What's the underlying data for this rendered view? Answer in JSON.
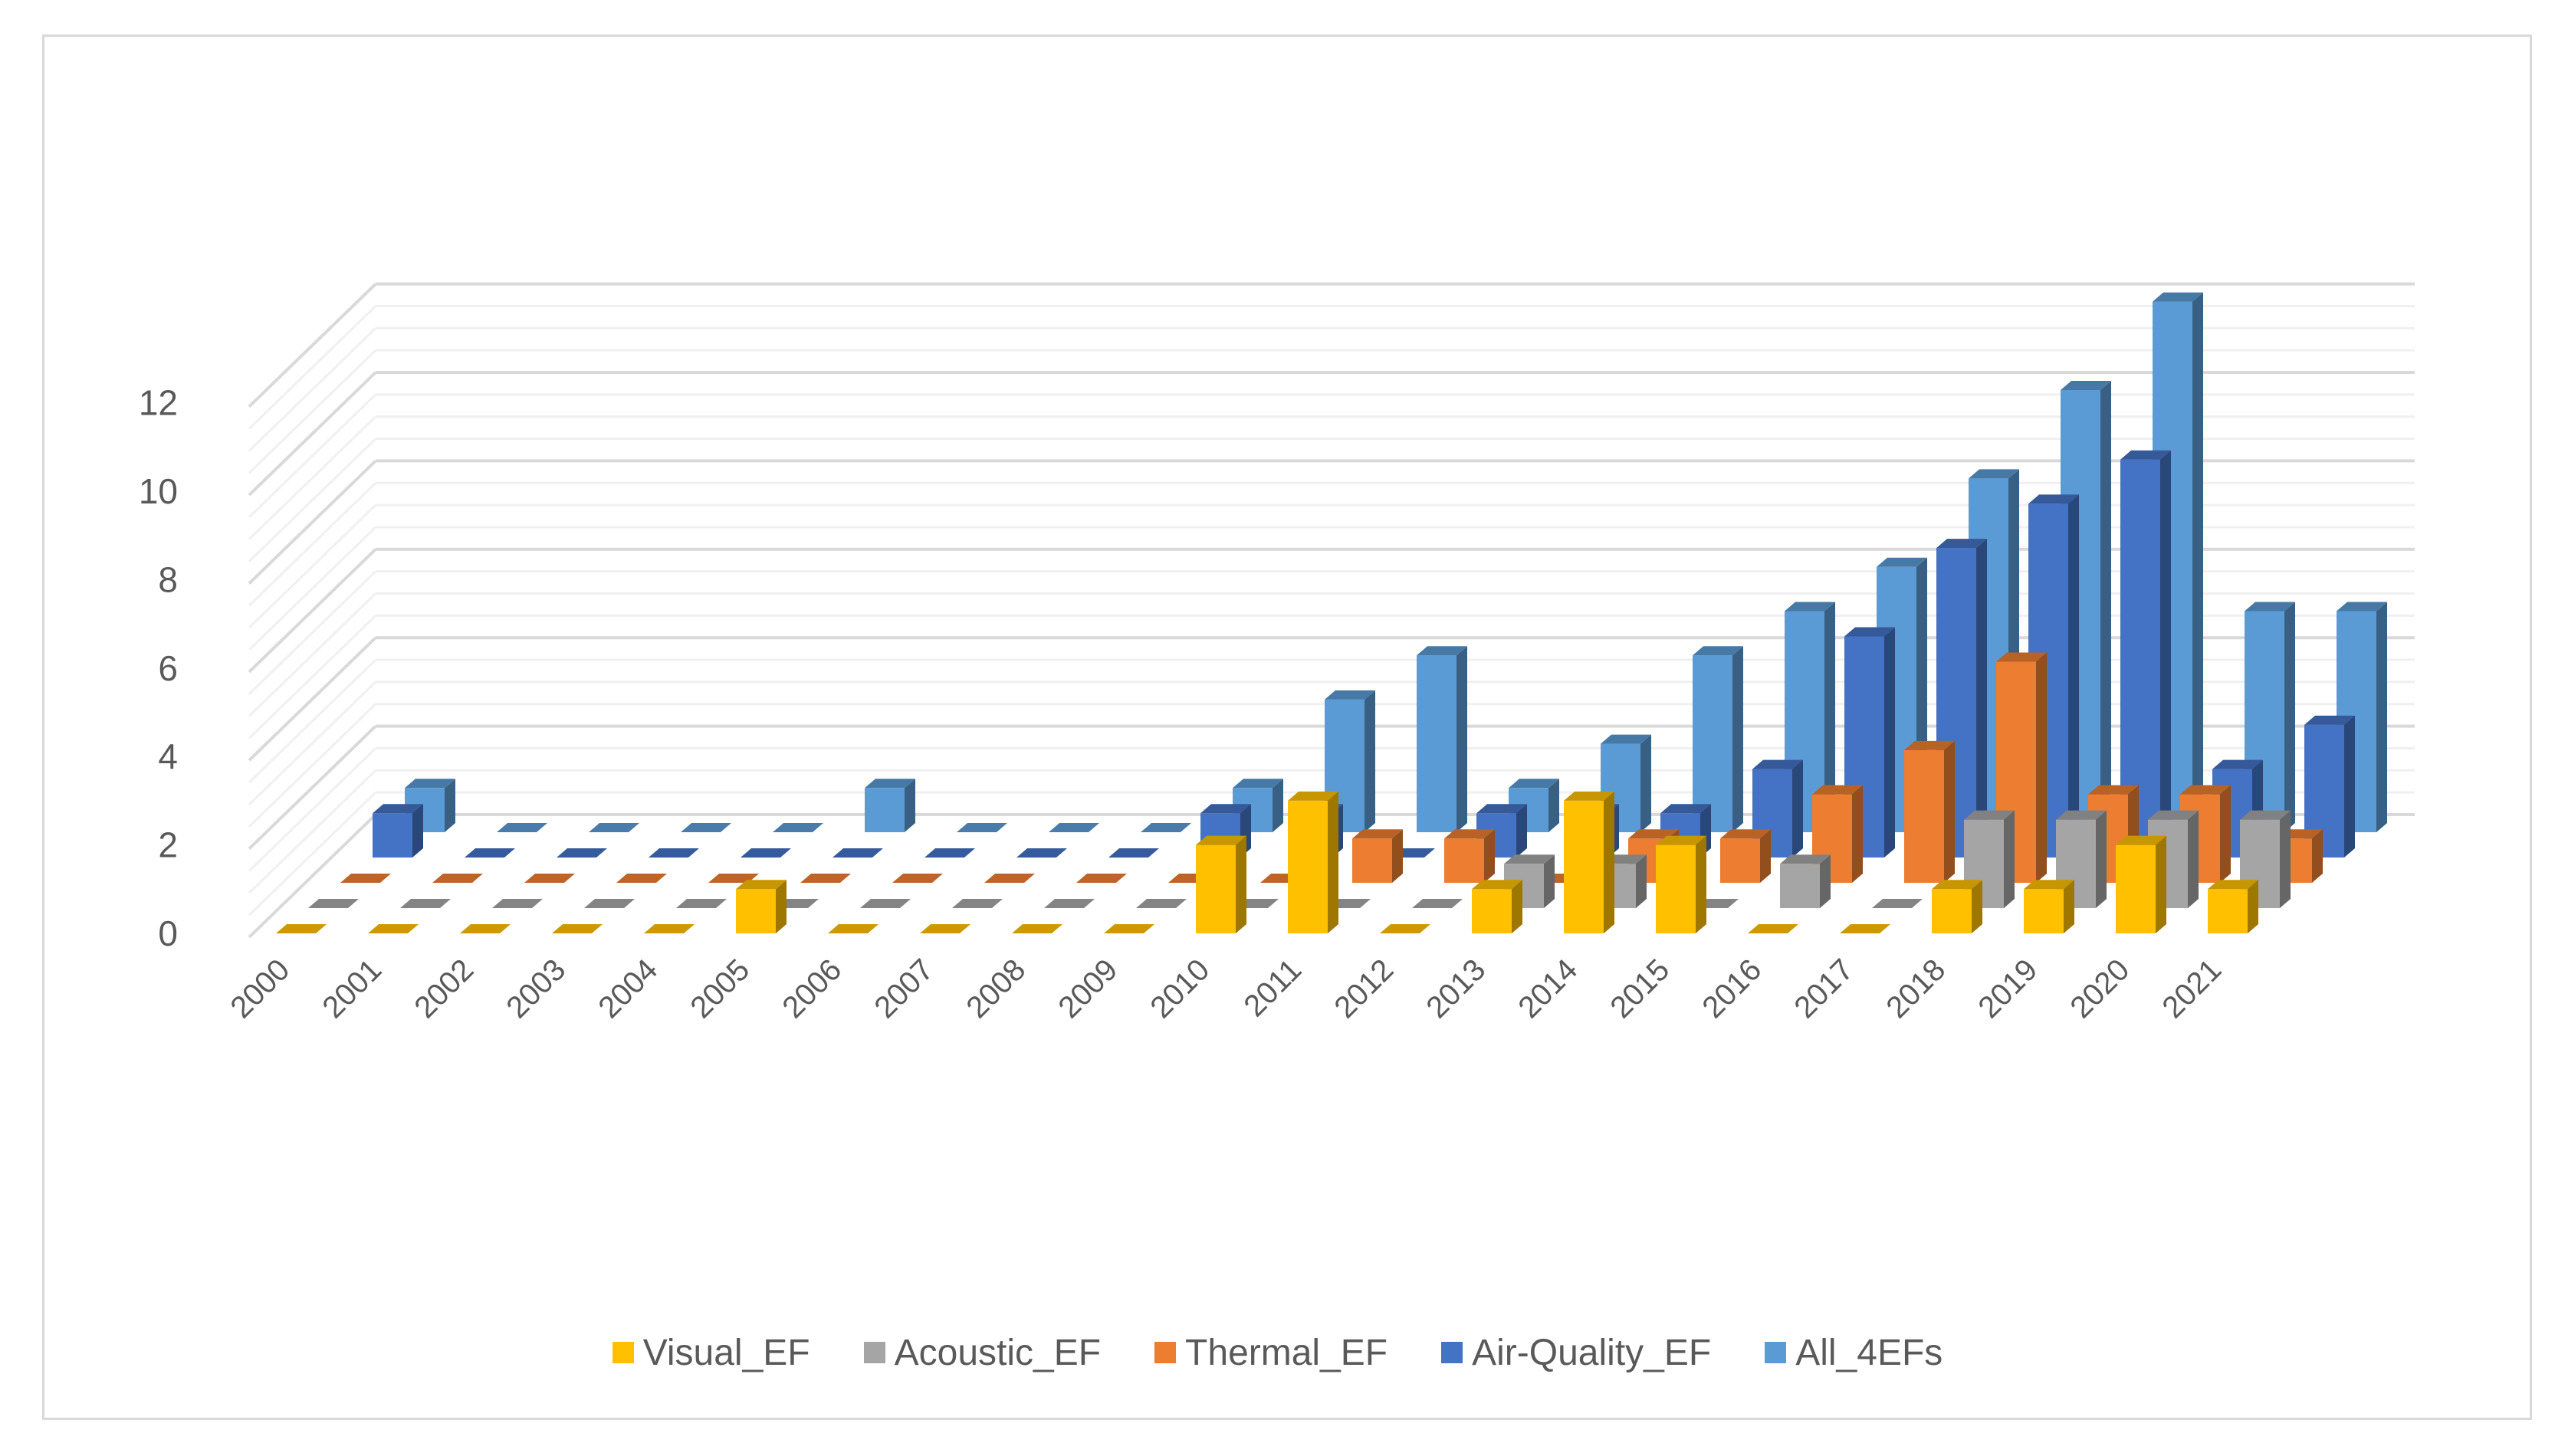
{
  "chart_data": {
    "type": "bar",
    "subtype": "3d-column",
    "title": "",
    "xlabel": "",
    "ylabel": "",
    "ylim": [
      0,
      12
    ],
    "yticks": [
      "0",
      "2",
      "4",
      "6",
      "8",
      "10",
      "12"
    ],
    "grid": true,
    "legend_position": "bottom",
    "categories": [
      "2000",
      "2001",
      "2002",
      "2003",
      "2004",
      "2005",
      "2006",
      "2007",
      "2008",
      "2009",
      "2010",
      "2011",
      "2012",
      "2013",
      "2014",
      "2015",
      "2016",
      "2017",
      "2018",
      "2019",
      "2020",
      "2021"
    ],
    "series": [
      {
        "name": "Visual_EF",
        "color": "#FFC000",
        "values": [
          0,
          0,
          0,
          0,
          0,
          1,
          0,
          0,
          0,
          0,
          2,
          3,
          0,
          1,
          3,
          2,
          0,
          0,
          1,
          1,
          2,
          1
        ]
      },
      {
        "name": "Acoustic_EF",
        "color": "#A5A5A5",
        "values": [
          0,
          0,
          0,
          0,
          0,
          0,
          0,
          0,
          0,
          0,
          0,
          0,
          0,
          1,
          1,
          0,
          1,
          0,
          2,
          2,
          2,
          2
        ]
      },
      {
        "name": "Thermal_EF",
        "color": "#ED7D31",
        "values": [
          0,
          0,
          0,
          0,
          0,
          0,
          0,
          0,
          0,
          0,
          0,
          1,
          1,
          0,
          1,
          1,
          2,
          3,
          5,
          2,
          2,
          1
        ]
      },
      {
        "name": "Air-Quality_EF",
        "color": "#4472C4",
        "values": [
          1,
          0,
          0,
          0,
          0,
          0,
          0,
          0,
          0,
          1,
          1,
          0,
          1,
          1,
          1,
          2,
          5,
          7,
          8,
          9,
          2,
          3
        ]
      },
      {
        "name": "All_4EFs",
        "color": "#5B9BD5",
        "values": [
          1,
          0,
          0,
          0,
          0,
          1,
          0,
          0,
          0,
          1,
          3,
          4,
          1,
          2,
          4,
          5,
          6,
          8,
          10,
          12,
          5,
          5
        ]
      }
    ]
  }
}
